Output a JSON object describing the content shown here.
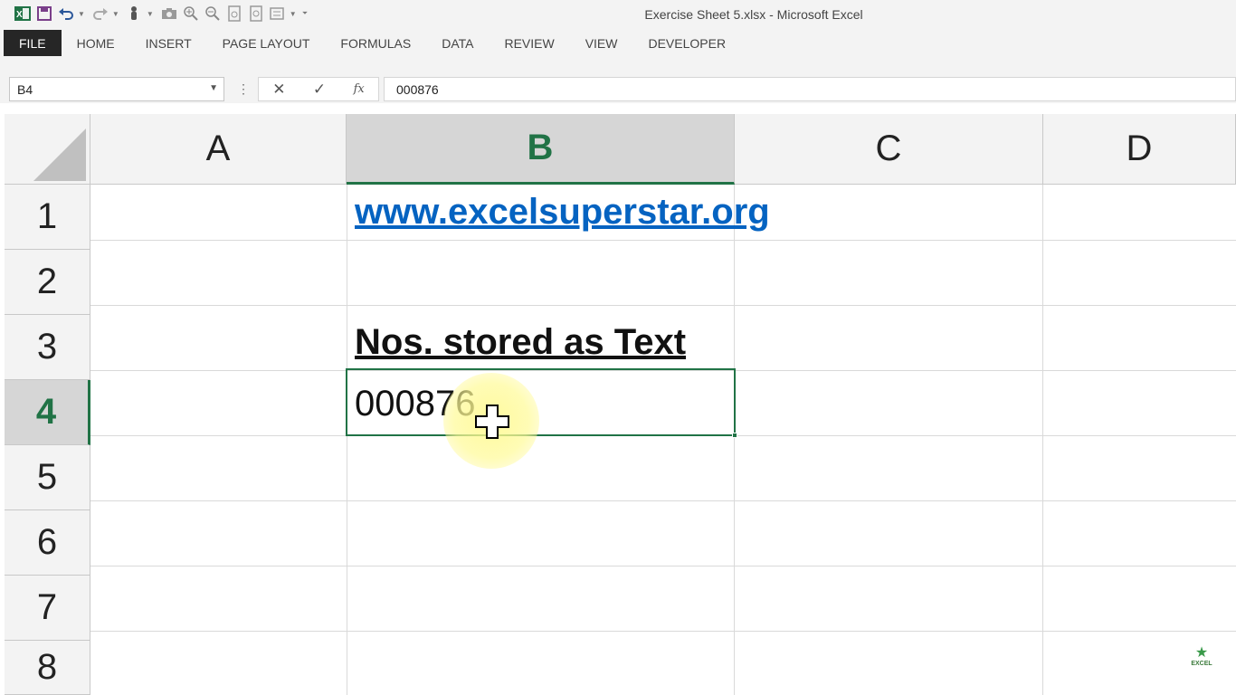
{
  "window": {
    "title": "Exercise Sheet 5.xlsx - Microsoft Excel"
  },
  "quick_access": [
    "excel-logo-icon",
    "save-icon",
    "undo-icon",
    "redo-icon",
    "touch-mode-icon",
    "camera-icon",
    "zoom-in-icon",
    "zoom-out-icon",
    "print-preview-icon",
    "page-view-icon",
    "form-icon",
    "customize-icon"
  ],
  "ribbon": {
    "tabs": [
      "FILE",
      "HOME",
      "INSERT",
      "PAGE LAYOUT",
      "FORMULAS",
      "DATA",
      "REVIEW",
      "VIEW",
      "DEVELOPER"
    ]
  },
  "formula_bar": {
    "name_box": "B4",
    "formula": "000876",
    "fx_label": "fx"
  },
  "grid": {
    "columns": [
      "A",
      "B",
      "C",
      "D"
    ],
    "selected_column": "B",
    "rows": [
      "1",
      "2",
      "3",
      "4",
      "5",
      "6",
      "7",
      "8"
    ],
    "selected_row": "4",
    "cells": {
      "B1": "www.excelsuperstar.org",
      "B3": "Nos. stored as Text",
      "B4": "000876"
    }
  },
  "watermark": {
    "line1": "EXCEL"
  },
  "colors": {
    "accent": "#217346",
    "link": "#0563c1",
    "chrome": "#f3f3f3"
  }
}
